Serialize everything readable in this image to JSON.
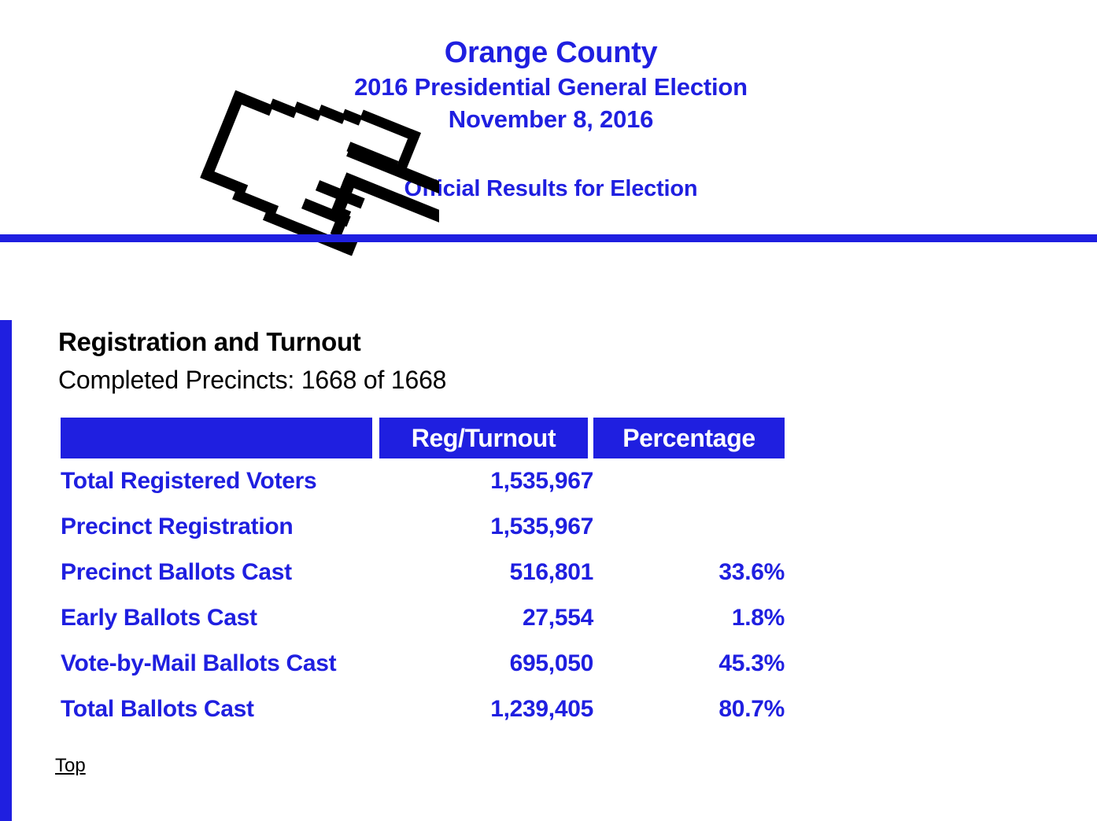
{
  "page": {
    "accent_blue": "#1f1fe0",
    "text_black": "#000000",
    "background": "#ffffff"
  },
  "header": {
    "county": "Orange County",
    "election": "2016 Presidential General Election",
    "date": "November 8, 2016",
    "official": "Official Results for Election",
    "icon": "pointing-hand-icon"
  },
  "main": {
    "section_title": "Registration and Turnout",
    "precincts": "Completed Precincts: 1668 of 1668",
    "table": {
      "columns": [
        "",
        "Reg/Turnout",
        "Percentage"
      ],
      "rows": [
        {
          "label": "Total Registered Voters",
          "value": "1,535,967",
          "percentage": ""
        },
        {
          "label": "Precinct Registration",
          "value": "1,535,967",
          "percentage": ""
        },
        {
          "label": "Precinct Ballots Cast",
          "value": "516,801",
          "percentage": "33.6%"
        },
        {
          "label": "Early Ballots Cast",
          "value": "27,554",
          "percentage": "1.8%"
        },
        {
          "label": "Vote-by-Mail Ballots Cast",
          "value": "695,050",
          "percentage": "45.3%"
        },
        {
          "label": "Total Ballots Cast",
          "value": "1,239,405",
          "percentage": "80.7%"
        }
      ]
    },
    "top_link": "Top "
  }
}
